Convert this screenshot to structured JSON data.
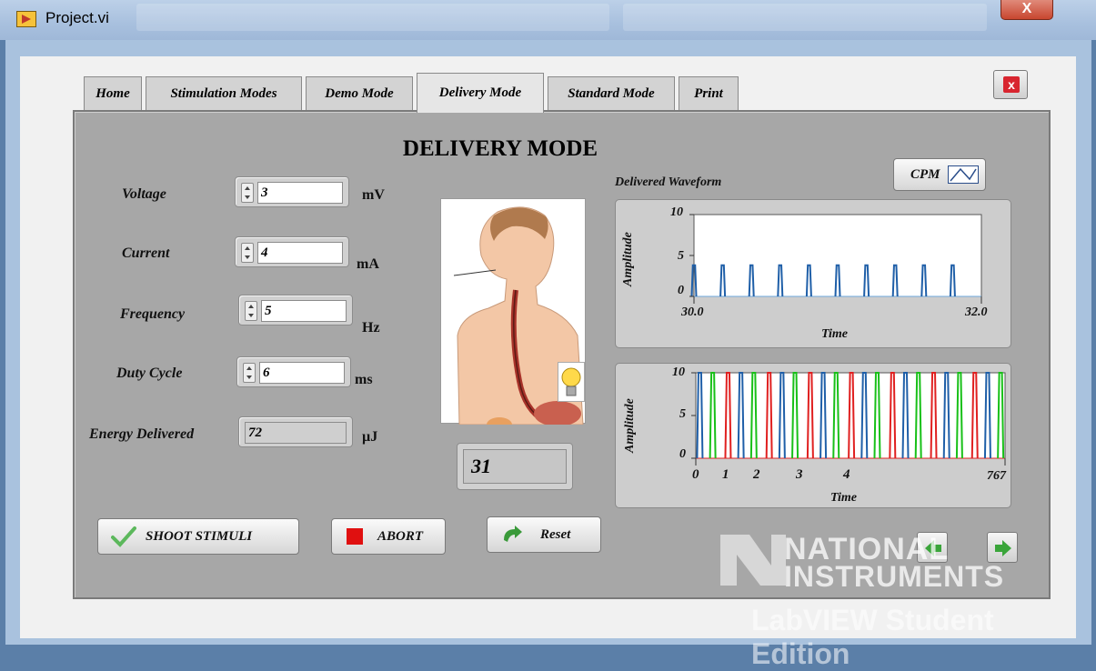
{
  "window": {
    "title": "Project.vi",
    "close_glyph": "X"
  },
  "tabs": [
    {
      "label": "Home"
    },
    {
      "label": "Stimulation Modes"
    },
    {
      "label": "Demo Mode"
    },
    {
      "label": "Delivery Mode"
    },
    {
      "label": "Standard Mode"
    },
    {
      "label": "Print"
    }
  ],
  "active_tab": "Delivery Mode",
  "panel_close_glyph": "x",
  "heading": "DELIVERY MODE",
  "controls": {
    "voltage": {
      "label": "Voltage",
      "value": "3",
      "unit": "mV"
    },
    "current": {
      "label": "Current",
      "value": "4",
      "unit": "mA"
    },
    "frequency": {
      "label": "Frequency",
      "value": "5",
      "unit": "Hz"
    },
    "duty_cycle": {
      "label": "Duty Cycle",
      "value": "6",
      "unit": "ms"
    },
    "energy": {
      "label": "Energy Delivered",
      "value": "72",
      "unit": "µJ"
    }
  },
  "count_display": "31",
  "buttons": {
    "shoot": "SHOOT  STIMULI",
    "abort": "ABORT",
    "reset": "Reset",
    "cpm": "CPM"
  },
  "icons": {
    "shoot": "check-icon",
    "abort": "stop-square-icon",
    "reset": "curved-arrow-icon",
    "cpm": "waveform-icon",
    "prev": "left-arrow-icon",
    "next": "right-arrow-icon",
    "bulb": "light-bulb-icon"
  },
  "colors": {
    "abort_red": "#e01010",
    "wave_blue": "#1f5fa8",
    "wave_green": "#18c018",
    "wave_red": "#e02020",
    "nav_green": "#3aa53a"
  },
  "graph1": {
    "title": "Delivered Waveform",
    "xlabel": "Time",
    "ylabel": "Amplitude",
    "xticks": [
      "30.0",
      "32.0"
    ],
    "yticks": [
      "10",
      "5",
      "0"
    ]
  },
  "graph2": {
    "xlabel": "Time",
    "ylabel": "Amplitude",
    "xticks": [
      "0",
      "1",
      "2",
      "3",
      "4",
      "767"
    ],
    "yticks": [
      "10",
      "5",
      "0"
    ]
  },
  "chart_data": [
    {
      "type": "line",
      "title": "Delivered Waveform",
      "xlabel": "Time",
      "ylabel": "Amplitude",
      "xlim": [
        30.0,
        32.0
      ],
      "ylim": [
        0,
        10
      ],
      "series": [
        {
          "pulse_height": 3.8,
          "pulse_x": [
            30.0,
            30.2,
            30.4,
            30.6,
            30.8,
            31.0,
            31.2,
            31.4,
            31.6,
            31.8
          ]
        }
      ]
    },
    {
      "type": "line",
      "xlabel": "Time",
      "ylabel": "Amplitude",
      "xlim": [
        0,
        767
      ],
      "ylim": [
        0,
        10
      ],
      "series": [
        {
          "color": "blue",
          "pulse_height": 10,
          "pulse_x": [
            10,
            112,
            214,
            316,
            418,
            520,
            622,
            724
          ]
        },
        {
          "color": "green",
          "pulse_height": 10,
          "pulse_x": [
            42,
            144,
            246,
            348,
            450,
            552,
            654,
            756
          ]
        },
        {
          "color": "red",
          "pulse_height": 10,
          "pulse_x": [
            80,
            182,
            284,
            386,
            488,
            590,
            692
          ]
        }
      ]
    }
  ],
  "watermark": {
    "brand1": "NATIONAL",
    "brand2": "INSTRUMENTS",
    "edition": "LabVIEW Student Edition"
  }
}
